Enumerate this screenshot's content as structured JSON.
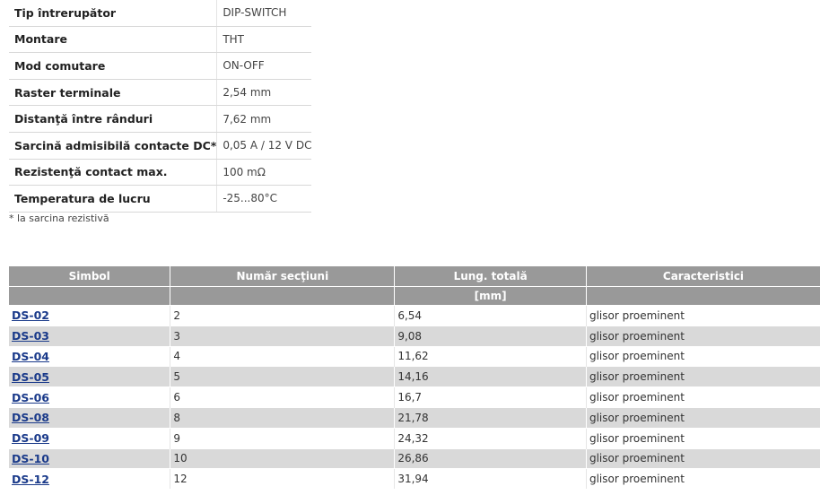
{
  "specs": [
    {
      "label": "Tip întrerupător",
      "value": "DIP-SWITCH"
    },
    {
      "label": "Montare",
      "value": "THT"
    },
    {
      "label": "Mod comutare",
      "value": "ON-OFF"
    },
    {
      "label": "Raster terminale",
      "value": "2,54 mm"
    },
    {
      "label": "Distanţă între rânduri",
      "value": "7,62 mm"
    },
    {
      "label": "Sarcină admisibilă contacte DC*",
      "value": "0,05 A / 12 V DC"
    },
    {
      "label": "Rezistenţă contact max.",
      "value": "100 mΩ"
    },
    {
      "label": "Temperatura de lucru",
      "value": "-25...80°C"
    }
  ],
  "footnote": "* la sarcina rezistivă",
  "table": {
    "headers": [
      "Simbol",
      "Număr secţiuni",
      "Lung. totală",
      "Caracteristici"
    ],
    "subheaders": [
      "",
      "",
      "[mm]",
      ""
    ],
    "rows": [
      {
        "symbol": "DS-02",
        "sections": "2",
        "length": "6,54",
        "feature": "glisor proeminent"
      },
      {
        "symbol": "DS-03",
        "sections": "3",
        "length": "9,08",
        "feature": "glisor proeminent"
      },
      {
        "symbol": "DS-04",
        "sections": "4",
        "length": "11,62",
        "feature": "glisor proeminent"
      },
      {
        "symbol": "DS-05",
        "sections": "5",
        "length": "14,16",
        "feature": "glisor proeminent"
      },
      {
        "symbol": "DS-06",
        "sections": "6",
        "length": "16,7",
        "feature": "glisor proeminent"
      },
      {
        "symbol": "DS-08",
        "sections": "8",
        "length": "21,78",
        "feature": "glisor proeminent"
      },
      {
        "symbol": "DS-09",
        "sections": "9",
        "length": "24,32",
        "feature": "glisor proeminent"
      },
      {
        "symbol": "DS-10",
        "sections": "10",
        "length": "26,86",
        "feature": "glisor proeminent"
      },
      {
        "symbol": "DS-12",
        "sections": "12",
        "length": "31,94",
        "feature": "glisor proeminent"
      }
    ]
  }
}
